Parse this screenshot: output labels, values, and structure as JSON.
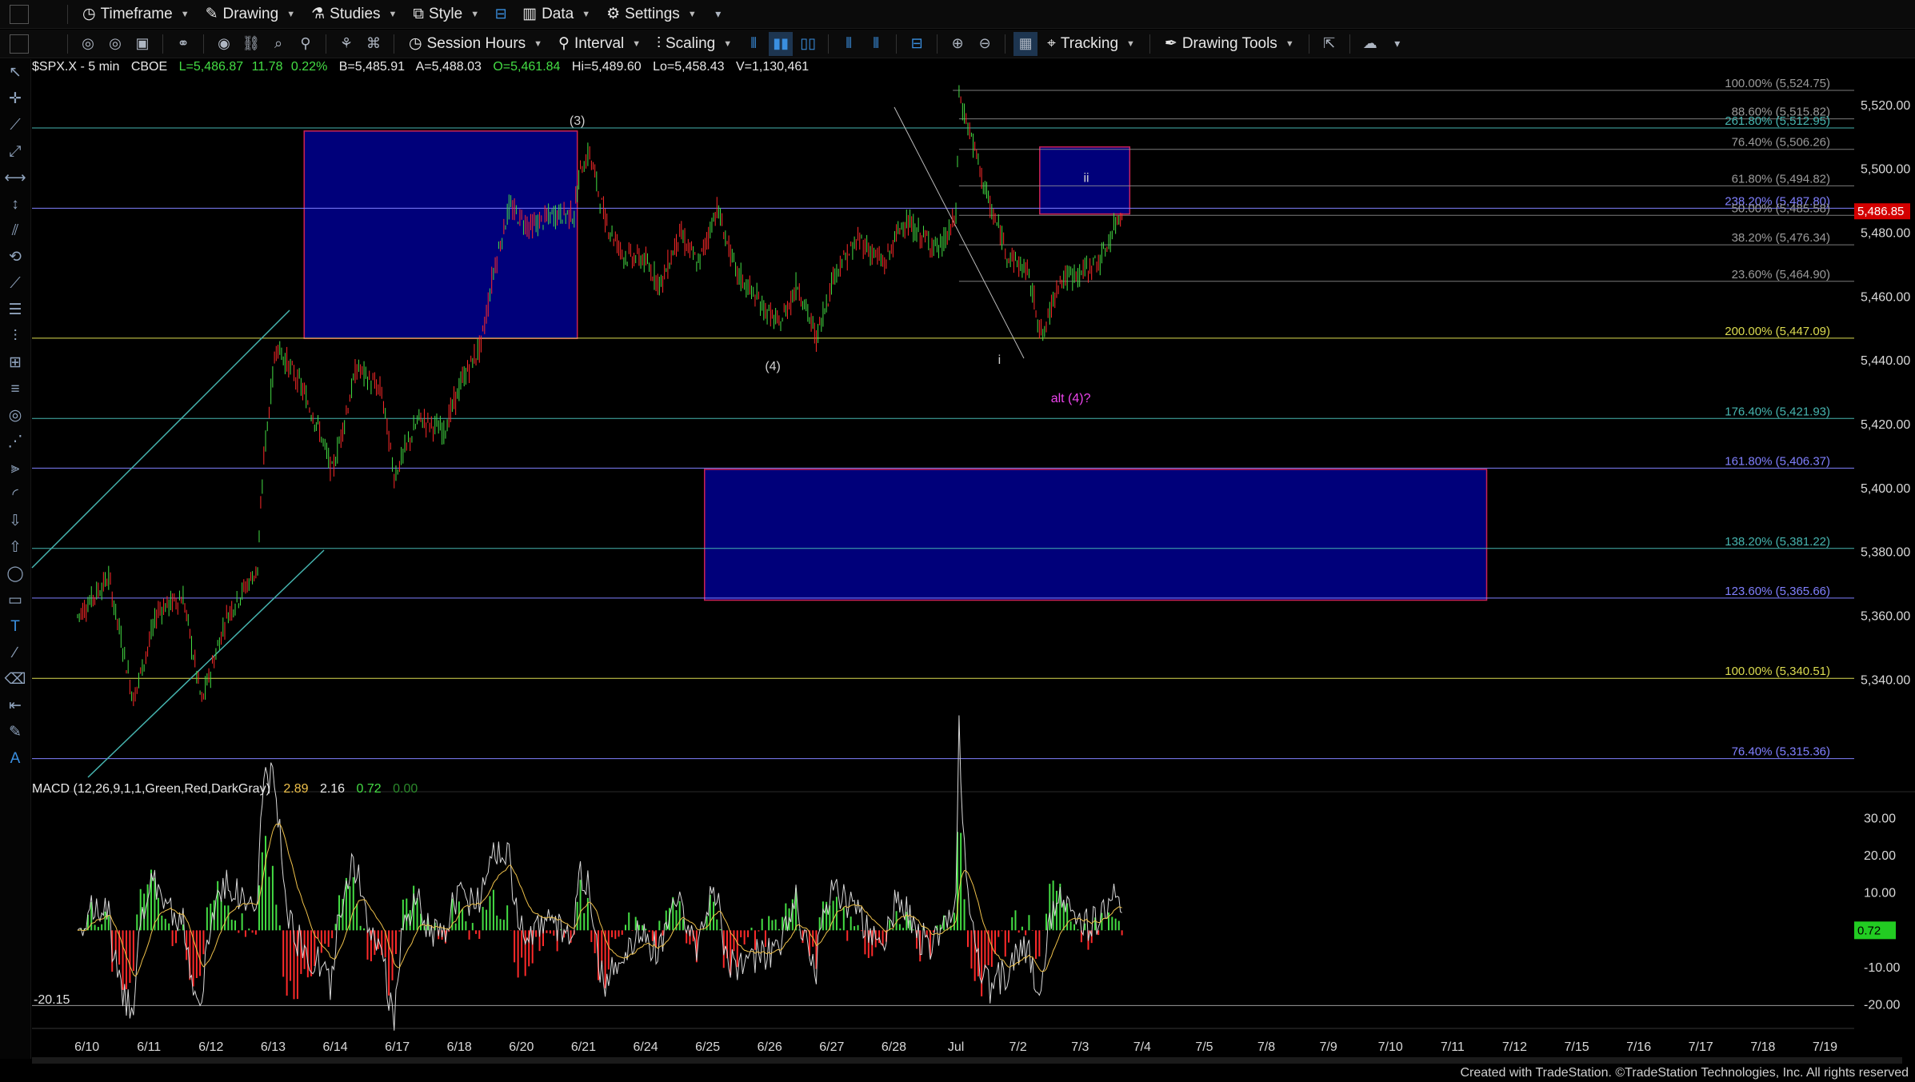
{
  "toolbar1": {
    "items": [
      {
        "label": "Timeframe",
        "icon": "clock-icon"
      },
      {
        "label": "Drawing",
        "icon": "pencil-icon"
      },
      {
        "label": "Studies",
        "icon": "flask-icon"
      },
      {
        "label": "Style",
        "icon": "style-icon"
      },
      {
        "label": "",
        "icon": "layout-icon"
      },
      {
        "label": "Data",
        "icon": "bars-icon"
      },
      {
        "label": "Settings",
        "icon": "gear-icon"
      }
    ]
  },
  "toolbar2": {
    "session_hours": "Session Hours",
    "interval": "Interval",
    "scaling": "Scaling",
    "tracking": "Tracking",
    "drawing_tools": "Drawing Tools"
  },
  "symbol_bar": {
    "symbol": "$SPX.X - 5 min",
    "exchange": "CBOE",
    "last": "L=5,486.87",
    "change": "11.78",
    "change_pct": "0.22%",
    "bid": "B=5,485.91",
    "ask": "A=5,488.03",
    "open": "O=5,461.84",
    "high": "Hi=5,489.60",
    "low": "Lo=5,458.43",
    "volume": "V=1,130,461"
  },
  "colors": {
    "up": "#44dd44",
    "down": "#ff2a2a",
    "box_fill": "#00007a",
    "box_border": "#cc2255",
    "fib_cyan": "#46b5b0",
    "fib_yellow": "#dcdc50",
    "fib_purple": "#8080ff",
    "fib_gray": "#9a9a9a",
    "price_tag": "#d40000"
  },
  "chart_data": {
    "type": "line",
    "title": "",
    "price_axis": {
      "ylim": [
        5310,
        5530
      ],
      "ticks": [
        "5,520.00",
        "5,500.00",
        "5,480.00",
        "5,460.00",
        "5,440.00",
        "5,420.00",
        "5,400.00",
        "5,380.00",
        "5,360.00",
        "5,340.00"
      ]
    },
    "current_price_tag": "5,486.85",
    "x_labels": [
      "6/10",
      "6/11",
      "6/12",
      "6/13",
      "6/14",
      "6/17",
      "6/18",
      "6/20",
      "6/21",
      "6/24",
      "6/25",
      "6/26",
      "6/27",
      "6/28",
      "Jul",
      "7/2",
      "7/3",
      "7/4",
      "7/5",
      "7/8",
      "7/9",
      "7/10",
      "7/11",
      "7/12",
      "7/15",
      "7/16",
      "7/17",
      "7/18",
      "7/19"
    ],
    "price_path": [
      [
        0,
        5360
      ],
      [
        0.5,
        5372
      ],
      [
        0.9,
        5334
      ],
      [
        1.3,
        5362
      ],
      [
        1.7,
        5366
      ],
      [
        2.0,
        5333
      ],
      [
        2.4,
        5360
      ],
      [
        2.9,
        5375
      ],
      [
        3.0,
        5410
      ],
      [
        3.2,
        5445
      ],
      [
        3.6,
        5432
      ],
      [
        3.9,
        5418
      ],
      [
        4.1,
        5405
      ],
      [
        4.5,
        5438
      ],
      [
        4.9,
        5430
      ],
      [
        5.1,
        5404
      ],
      [
        5.5,
        5422
      ],
      [
        5.9,
        5418
      ],
      [
        6.2,
        5434
      ],
      [
        6.5,
        5445
      ],
      [
        6.7,
        5468
      ],
      [
        6.95,
        5488
      ],
      [
        7.3,
        5482
      ],
      [
        7.7,
        5486
      ],
      [
        8.0,
        5486
      ],
      [
        8.1,
        5500
      ],
      [
        8.25,
        5505
      ],
      [
        8.5,
        5484
      ],
      [
        8.8,
        5473
      ],
      [
        9.1,
        5472
      ],
      [
        9.4,
        5464
      ],
      [
        9.7,
        5480
      ],
      [
        10.0,
        5470
      ],
      [
        10.3,
        5488
      ],
      [
        10.6,
        5468
      ],
      [
        11.0,
        5458
      ],
      [
        11.3,
        5451
      ],
      [
        11.6,
        5464
      ],
      [
        11.9,
        5447
      ],
      [
        12.2,
        5468
      ],
      [
        12.6,
        5478
      ],
      [
        13.0,
        5470
      ],
      [
        13.3,
        5484
      ],
      [
        13.6,
        5479
      ],
      [
        13.9,
        5475
      ],
      [
        14.15,
        5485
      ],
      [
        14.2,
        5523
      ],
      [
        14.4,
        5510
      ],
      [
        14.7,
        5488
      ],
      [
        15.0,
        5473
      ],
      [
        15.3,
        5468
      ],
      [
        15.55,
        5447
      ],
      [
        15.8,
        5465
      ],
      [
        16.2,
        5468
      ],
      [
        16.5,
        5472
      ],
      [
        16.75,
        5484
      ],
      [
        16.85,
        5488
      ]
    ],
    "macd": {
      "label": "MACD (12,26,9,1,1,Green,Red,DarkGray)",
      "macd": "2.89",
      "signal": "2.16",
      "diff": "0.72",
      "zero": "0.00",
      "ylim": [
        -25,
        35
      ],
      "ticks": [
        "30.00",
        "20.00",
        "10.00",
        "-10.00",
        "-20.00"
      ],
      "side_tag": "0.72",
      "low_label": "-20.15"
    },
    "fib_levels": [
      {
        "label": "100.00% (5,524.75)",
        "value": 5524.75,
        "color": "gray",
        "x0": 14.1
      },
      {
        "label": "88.60% (5,515.82)",
        "value": 5515.82,
        "color": "gray",
        "x0": 14.2
      },
      {
        "label": "261.80% (5,512.95)",
        "value": 5512.95,
        "color": "cyan",
        "x0": 0
      },
      {
        "label": "76.40% (5,506.26)",
        "value": 5506.26,
        "color": "gray",
        "x0": 14.2
      },
      {
        "label": "61.80% (5,494.82)",
        "value": 5494.82,
        "color": "gray",
        "x0": 14.2
      },
      {
        "label": "238.20% (5,487.80)",
        "value": 5487.8,
        "color": "purple",
        "x0": 0
      },
      {
        "label": "50.00% (5,485.58)",
        "value": 5485.58,
        "color": "gray",
        "x0": 14.2
      },
      {
        "label": "38.20% (5,476.34)",
        "value": 5476.34,
        "color": "gray",
        "x0": 14.2
      },
      {
        "label": "23.60% (5,464.90)",
        "value": 5464.9,
        "color": "gray",
        "x0": 14.2
      },
      {
        "label": "200.00% (5,447.09)",
        "value": 5447.09,
        "color": "yellow",
        "x0": 0
      },
      {
        "label": "176.40% (5,421.93)",
        "value": 5421.93,
        "color": "cyan",
        "x0": 0
      },
      {
        "label": "161.80% (5,406.37)",
        "value": 5406.37,
        "color": "purple",
        "x0": 0
      },
      {
        "label": "138.20% (5,381.22)",
        "value": 5381.22,
        "color": "cyan",
        "x0": 0
      },
      {
        "label": "123.60% (5,365.66)",
        "value": 5365.66,
        "color": "purple",
        "x0": 0
      },
      {
        "label": "100.00% (5,340.51)",
        "value": 5340.51,
        "color": "yellow",
        "x0": 0
      },
      {
        "label": "76.40% (5,315.36)",
        "value": 5315.36,
        "color": "purple",
        "x0": 0
      }
    ],
    "boxes": [
      {
        "x0": 3.65,
        "x1": 8.05,
        "y0": 5447,
        "y1": 5512
      },
      {
        "x0": 15.5,
        "x1": 16.95,
        "y0": 5486,
        "y1": 5507
      },
      {
        "x0": 10.1,
        "x1": 22.7,
        "y0": 5365,
        "y1": 5406
      }
    ],
    "labels": [
      {
        "text": "(3)",
        "x": 8.05,
        "y": 5514,
        "color": "#d0d0d0"
      },
      {
        "text": "(4)",
        "x": 11.2,
        "y": 5437,
        "color": "#d0d0d0"
      },
      {
        "text": "i",
        "x": 14.85,
        "y": 5439,
        "color": "#d0d0d0"
      },
      {
        "text": "ii",
        "x": 16.25,
        "y": 5496,
        "color": "#d0d0d0"
      },
      {
        "text": "alt (4)?",
        "x": 16.0,
        "y": 5427,
        "color": "#ee44ee"
      }
    ]
  },
  "footer": "Created with TradeStation. ©TradeStation Technologies, Inc. All rights reserved"
}
